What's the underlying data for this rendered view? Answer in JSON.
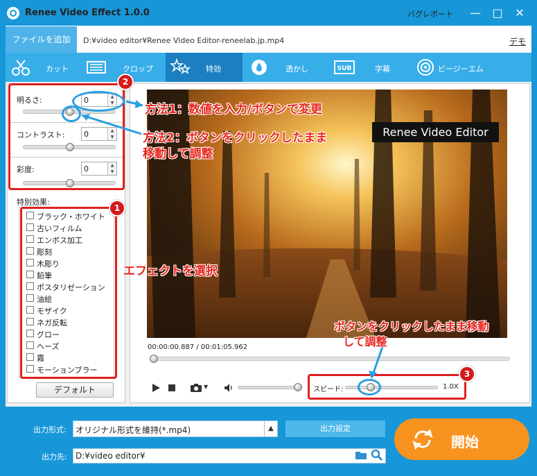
{
  "app": {
    "title": "Renee Video Effect 1.0.0",
    "bug_report": "バグレポート",
    "minimize": "—",
    "maximize": "□",
    "close": "✕"
  },
  "file": {
    "add_button": "ファイルを追加",
    "path": "D:¥video editor¥Renee Video Editor-reneelab.jp.mp4",
    "demo": "デモ"
  },
  "tabs": [
    {
      "label": "カット",
      "icon": "scissors-icon"
    },
    {
      "label": "クロップ",
      "icon": "crop-icon"
    },
    {
      "label": "特効",
      "icon": "stars-icon"
    },
    {
      "label": "透かし",
      "icon": "drop-icon"
    },
    {
      "label": "字幕",
      "icon": "subtitle-icon"
    },
    {
      "label": "ビージーエム",
      "icon": "music-icon"
    }
  ],
  "adjust": {
    "brightness_label": "明るさ:",
    "brightness_value": "0",
    "contrast_label": "コントラスト:",
    "contrast_value": "0",
    "saturation_label": "彩度:",
    "saturation_value": "0"
  },
  "effects": {
    "title": "特別効果:",
    "items": [
      "ブラック・ホワイト",
      "古いフィルム",
      "エンボス加工",
      "彫刻",
      "木彫り",
      "鉛筆",
      "ポスタリゼーション",
      "油絵",
      "モザイク",
      "ネガ反転",
      "グロー",
      "ヘーズ",
      "霧",
      "モーションブラー"
    ],
    "default_button": "デフォルト"
  },
  "player": {
    "watermark": "Renee Video Editor",
    "time": "00:00:00.887 / 00:01:05.962",
    "speed_label": "スピード:",
    "speed_value": "1.0X",
    "volume_level": 0.92,
    "speed_position": 0.28,
    "progress": 0.013
  },
  "output": {
    "format_label": "出力形式:",
    "format_value": "オリジナル形式を維持(*.mp4)",
    "settings_button": "出力設定",
    "dest_label": "出力先:",
    "dest_value": "D:¥video editor¥",
    "start_button": "開始"
  },
  "annotations": {
    "badge1": "1",
    "badge2": "2",
    "badge3": "3",
    "method1": "方法1：数値を入力/ボタンで変更",
    "method2_line1": "方法2：ボタンをクリックしたまま",
    "method2_line2": "移動して調整",
    "select_effect": "エフェクトを選択",
    "speed_note_line1": "ボタンをクリックしたまま移動",
    "speed_note_line2": "して調整"
  },
  "colors": {
    "primary_blue": "#1797d8",
    "tab_blue": "#38aee9",
    "active_tab": "#1b7fc2",
    "start_orange": "#f7931e",
    "annotation_red": "#e02020",
    "annotation_blue": "#2a9fe0"
  }
}
